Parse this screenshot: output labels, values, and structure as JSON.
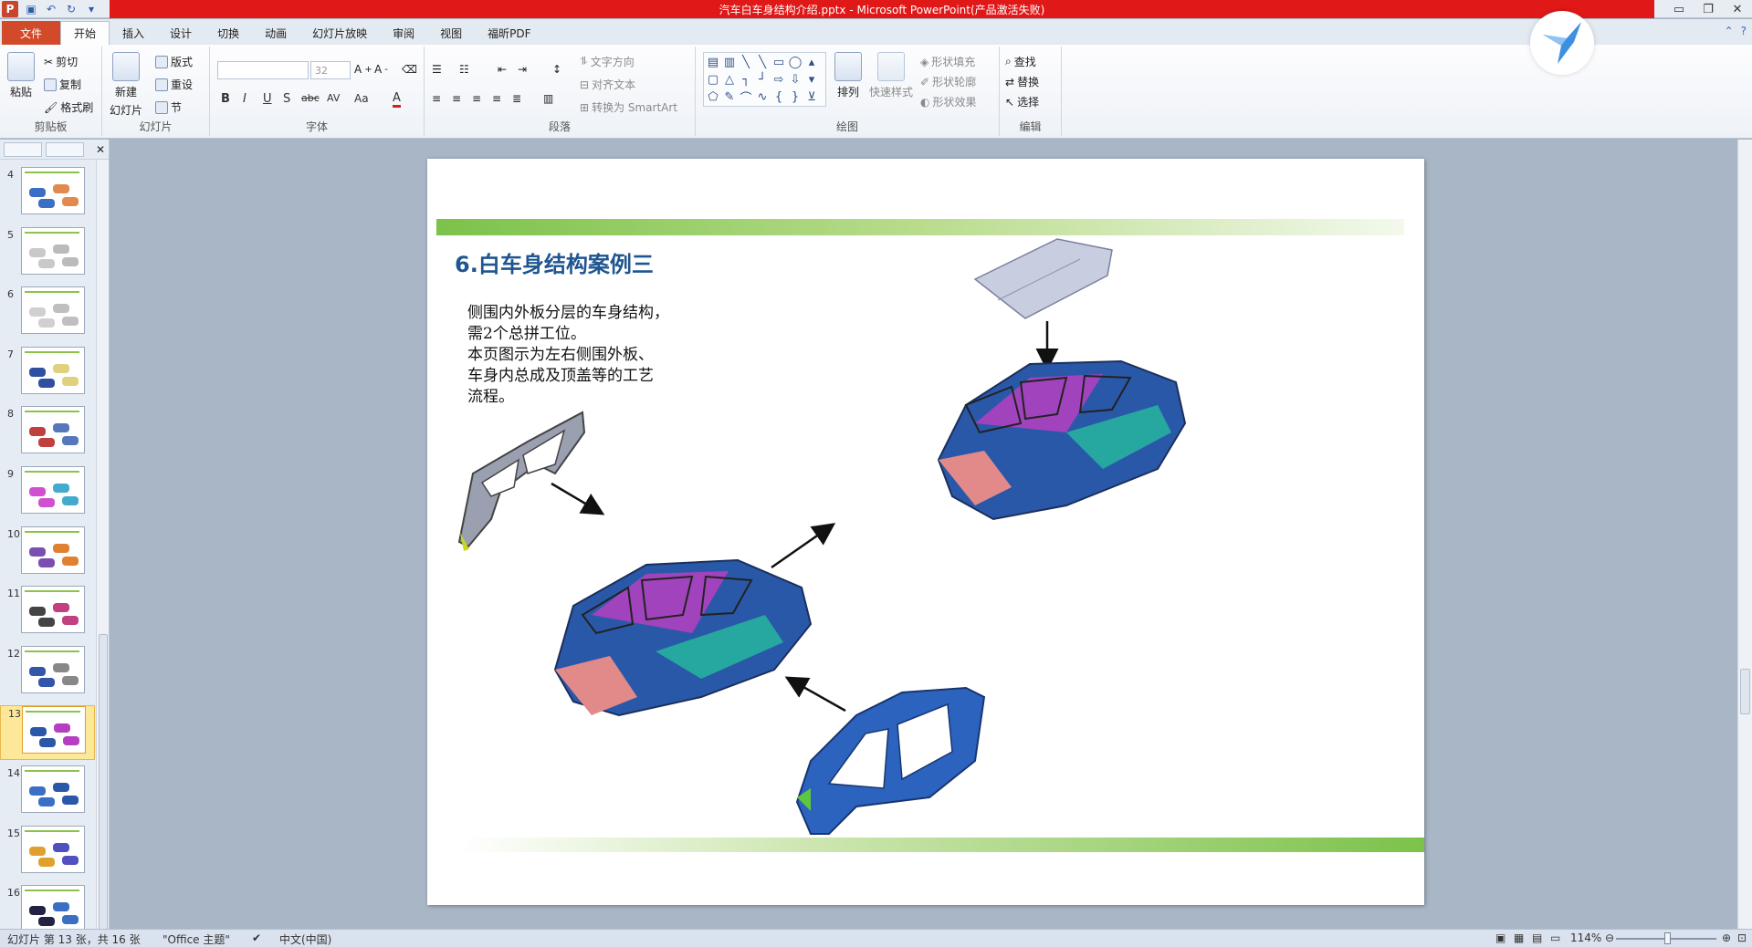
{
  "window": {
    "title": "汽车白车身结构介绍.pptx - Microsoft PowerPoint(产品激活失败)",
    "app_icon": "P"
  },
  "tabs": [
    {
      "label": "文件"
    },
    {
      "label": "开始"
    },
    {
      "label": "插入"
    },
    {
      "label": "设计"
    },
    {
      "label": "切换"
    },
    {
      "label": "动画"
    },
    {
      "label": "幻灯片放映"
    },
    {
      "label": "审阅"
    },
    {
      "label": "视图"
    },
    {
      "label": "福昕PDF"
    }
  ],
  "ribbon": {
    "clipboard": {
      "paste": "粘贴",
      "cut": "剪切",
      "copy": "复制",
      "format_painter": "格式刷",
      "label": "剪贴板"
    },
    "slides": {
      "new_slide_line1": "新建",
      "new_slide_line2": "幻灯片",
      "layout": "版式",
      "reset": "重设",
      "section": "节",
      "label": "幻灯片"
    },
    "font": {
      "font_size": "32",
      "label": "字体",
      "bold": "B",
      "italic": "I",
      "underline": "U",
      "strike": "S",
      "shadow": "abc",
      "spacing": "AV",
      "case": "Aa",
      "color": "A"
    },
    "paragraph": {
      "text_direction": "文字方向",
      "align_text": "对齐文本",
      "smartart": "转换为 SmartArt",
      "label": "段落"
    },
    "drawing": {
      "arrange": "排列",
      "quick_styles": "快速样式",
      "shape_fill": "形状填充",
      "shape_outline": "形状轮廓",
      "shape_effects": "形状效果",
      "label": "绘图"
    },
    "editing": {
      "find": "查找",
      "replace": "替换",
      "select": "选择",
      "label": "编辑"
    }
  },
  "thumbnails": [
    {
      "num": "4"
    },
    {
      "num": "5"
    },
    {
      "num": "6"
    },
    {
      "num": "7"
    },
    {
      "num": "8"
    },
    {
      "num": "9"
    },
    {
      "num": "10"
    },
    {
      "num": "11"
    },
    {
      "num": "12"
    },
    {
      "num": "13"
    },
    {
      "num": "14"
    },
    {
      "num": "15"
    },
    {
      "num": "16"
    }
  ],
  "selected_slide": "13",
  "slide": {
    "title": "6.白车身结构案例三",
    "body": [
      "侧围内外板分层的车身结构，",
      "需2个总拼工位。",
      "本页图示为左右侧围外板、",
      "车身内总成及顶盖等的工艺",
      "流程。"
    ]
  },
  "status": {
    "slide_info": "幻灯片 第 13 张，共 16 张",
    "theme": "\"Office 主题\"",
    "language": "中文(中国)",
    "zoom": "114%"
  },
  "colors": {
    "title_red": "#e01818",
    "file_tab": "#d24a2a",
    "slide_title": "#1f5590",
    "green_band": "#7cc24a",
    "selected_thumb": "#fde89a"
  }
}
